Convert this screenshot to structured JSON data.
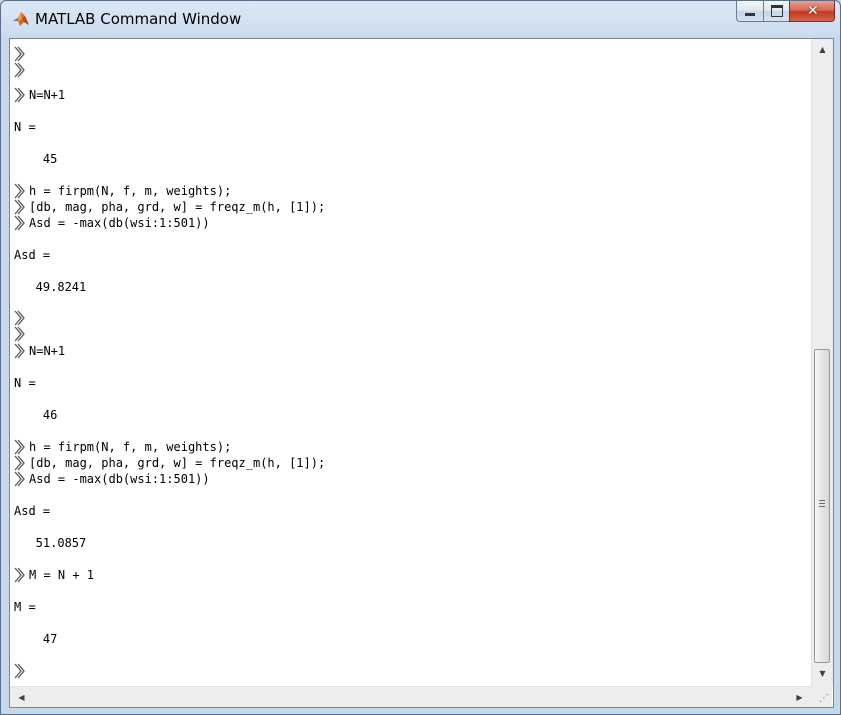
{
  "window": {
    "title": "MATLAB Command Window",
    "icon": "matlab-membrane-icon",
    "caption_buttons": [
      {
        "name": "minimize",
        "glyph": "minimize-icon"
      },
      {
        "name": "maximize",
        "glyph": "maximize-icon"
      },
      {
        "name": "close",
        "glyph": "close-icon",
        "label": "✕"
      }
    ],
    "close_color": "#c2371f"
  },
  "console": {
    "prompt_icon": "command-prompt-chevron-icon",
    "lines": [
      {
        "kind": "prompt",
        "text": ""
      },
      {
        "kind": "prompt",
        "text": ""
      },
      {
        "kind": "prompt",
        "text": "N=N+1"
      },
      {
        "kind": "output",
        "text": "N ="
      },
      {
        "kind": "output",
        "text": "    45"
      },
      {
        "kind": "prompt",
        "text": "h = firpm(N, f, m, weights);"
      },
      {
        "kind": "prompt",
        "text": "[db, mag, pha, grd, w] = freqz_m(h, [1]);"
      },
      {
        "kind": "prompt",
        "text": "Asd = -max(db(wsi:1:501))"
      },
      {
        "kind": "output",
        "text": "Asd ="
      },
      {
        "kind": "output",
        "text": "   49.8241"
      },
      {
        "kind": "prompt",
        "text": ""
      },
      {
        "kind": "prompt",
        "text": ""
      },
      {
        "kind": "prompt",
        "text": "N=N+1"
      },
      {
        "kind": "output",
        "text": "N ="
      },
      {
        "kind": "output",
        "text": "    46"
      },
      {
        "kind": "prompt",
        "text": "h = firpm(N, f, m, weights);"
      },
      {
        "kind": "prompt",
        "text": "[db, mag, pha, grd, w] = freqz_m(h, [1]);"
      },
      {
        "kind": "prompt",
        "text": "Asd = -max(db(wsi:1:501))"
      },
      {
        "kind": "output",
        "text": "Asd ="
      },
      {
        "kind": "output",
        "text": "   51.0857"
      },
      {
        "kind": "prompt",
        "text": "M = N + 1"
      },
      {
        "kind": "output",
        "text": "M ="
      },
      {
        "kind": "output",
        "text": "    47"
      },
      {
        "kind": "prompt",
        "text": ""
      }
    ]
  },
  "scrollbars": {
    "vertical_position": 0.49,
    "up_icon": "scroll-up-arrow-icon",
    "down_icon": "scroll-down-arrow-icon",
    "left_icon": "scroll-left-arrow-icon",
    "right_icon": "scroll-right-arrow-icon"
  }
}
